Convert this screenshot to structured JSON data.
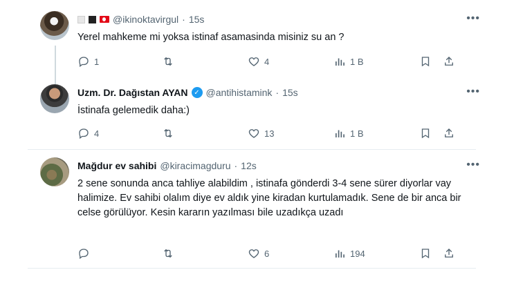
{
  "tweets": [
    {
      "name": "",
      "handle": "@ikinoktavirgul",
      "sep": "·",
      "time": "15s",
      "text": "Yerel mahkeme mi yoksa istinaf asamasinda misiniz su an ?",
      "replies": "1",
      "retweets": "",
      "likes": "4",
      "views": "1 B"
    },
    {
      "name": "Uzm. Dr. Dağıstan AYAN",
      "handle": "@antihistamink",
      "sep": "·",
      "time": "15s",
      "text": "İstinafa gelemedik daha:)",
      "replies": "4",
      "retweets": "",
      "likes": "13",
      "views": "1 B"
    },
    {
      "name": "Mağdur ev sahibi",
      "handle": "@kiracimagduru",
      "sep": "·",
      "time": "12s",
      "text": "2 sene sonunda anca tahliye alabildim , istinafa gönderdi 3-4 sene sürer diyorlar vay halimize. Ev sahibi olalım diye ev aldık yine kiradan kurtulamadık. Sene de bir anca bir celse görülüyor. Kesin kararın  yazılması bile uzadıkça uzadı",
      "replies": "",
      "retweets": "",
      "likes": "6",
      "views": "194"
    }
  ],
  "icons": {
    "reply": "reply-icon",
    "retweet": "retweet-icon",
    "like": "heart-icon",
    "views": "views-icon",
    "bookmark": "bookmark-icon",
    "share": "share-icon",
    "more": "more-icon",
    "verified": "verified-badge-icon"
  },
  "colors": {
    "text": "#0f1419",
    "muted": "#536471",
    "verified": "#1d9bf0",
    "divider": "#e6ecf0"
  }
}
